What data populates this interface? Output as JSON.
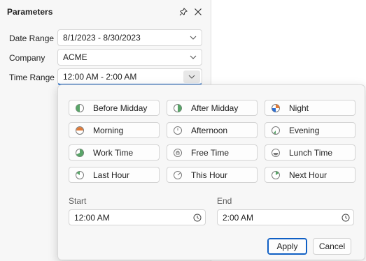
{
  "panel": {
    "title": "Parameters",
    "rows": [
      {
        "label": "Date Range",
        "value": "8/1/2023 - 8/30/2023"
      },
      {
        "label": "Company",
        "value": "ACME"
      },
      {
        "label": "Time Range",
        "value": "12:00 AM - 2:00 AM"
      }
    ]
  },
  "popup": {
    "presets": [
      {
        "label": "Before Midday",
        "icon": "before-midday-icon"
      },
      {
        "label": "After Midday",
        "icon": "after-midday-icon"
      },
      {
        "label": "Night",
        "icon": "night-icon"
      },
      {
        "label": "Morning",
        "icon": "morning-icon"
      },
      {
        "label": "Afternoon",
        "icon": "afternoon-icon"
      },
      {
        "label": "Evening",
        "icon": "evening-icon"
      },
      {
        "label": "Work Time",
        "icon": "work-time-icon"
      },
      {
        "label": "Free Time",
        "icon": "free-time-icon"
      },
      {
        "label": "Lunch Time",
        "icon": "lunch-time-icon"
      },
      {
        "label": "Last Hour",
        "icon": "last-hour-icon"
      },
      {
        "label": "This Hour",
        "icon": "this-hour-icon"
      },
      {
        "label": "Next Hour",
        "icon": "next-hour-icon"
      }
    ],
    "start": {
      "label": "Start",
      "value": "12:00 AM"
    },
    "end": {
      "label": "End",
      "value": "2:00 AM"
    },
    "apply_label": "Apply",
    "cancel_label": "Cancel"
  },
  "colors": {
    "accent": "#0f5fc4",
    "green": "#5aa469",
    "orange": "#e07b39",
    "blue": "#2f6fd1"
  }
}
